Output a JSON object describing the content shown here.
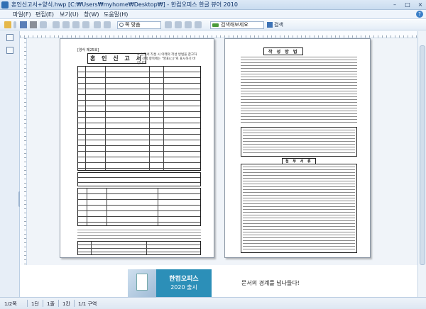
{
  "window": {
    "title": "혼인신고서+양식.hwp [C:₩Users₩myhome₩Desktop₩] - 한컴오피스 한글 뷰어 2010",
    "controls": [
      "–",
      "□",
      "×"
    ]
  },
  "menu": {
    "items": [
      "파일(F)",
      "편집(E)",
      "보기(U)",
      "창(W)",
      "도움말(H)"
    ]
  },
  "toolbar": {
    "zoom_value": "쪽 맞춤",
    "search_placeholder": "검색해보세요",
    "search_button": "검색"
  },
  "document": {
    "page1": {
      "header": "[양식 제25호]",
      "form_title": "혼 인 신 고 서",
      "note": "※ 신고서 작성 시 아래의 작성 방법을 참고하고, 선택 항목에는 \"영표(○)\"로 표시하기 바랍니다."
    },
    "page2": {
      "title": "작 성 방 법",
      "title2": "첨 부 서 류"
    }
  },
  "banner": {
    "line1": "한컴오피스",
    "line2": "2020 출시",
    "slogan": "문서의 경계를 넘나들다!"
  },
  "status": {
    "page": "1/2쪽",
    "section": "1단",
    "line": "1줄",
    "column": "1칸",
    "area": "1/1 구역"
  }
}
